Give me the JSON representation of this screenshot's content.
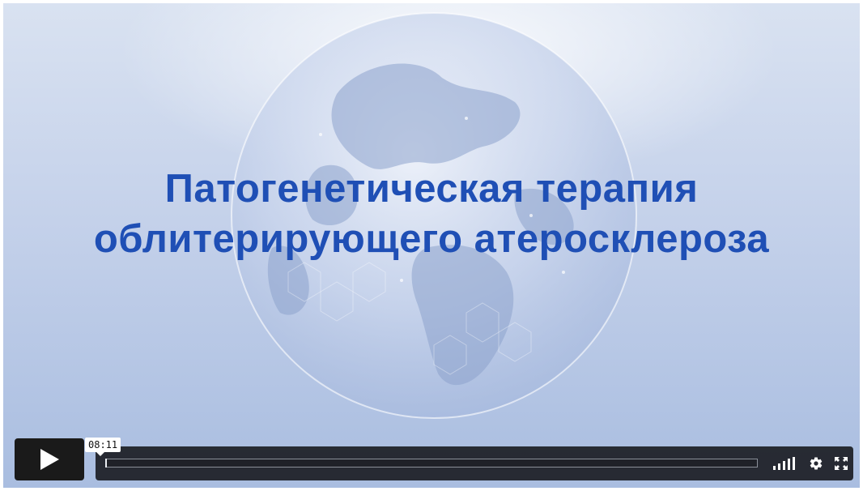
{
  "video": {
    "title_line_1": "Патогенетическая терапия",
    "title_line_2": "облитерирующего атеросклероза"
  },
  "controls": {
    "play_icon": "play-icon",
    "timestamp": "08:11",
    "progress": 0,
    "volume_icon": "volume-bars-icon",
    "settings_icon": "gear-icon",
    "fullscreen_icon": "fullscreen-icon"
  },
  "colors": {
    "title": "#1f4fb5",
    "control_bg": "#1a1a1a",
    "background_top": "#d9e2f1",
    "background_bottom": "#a9bde0"
  }
}
